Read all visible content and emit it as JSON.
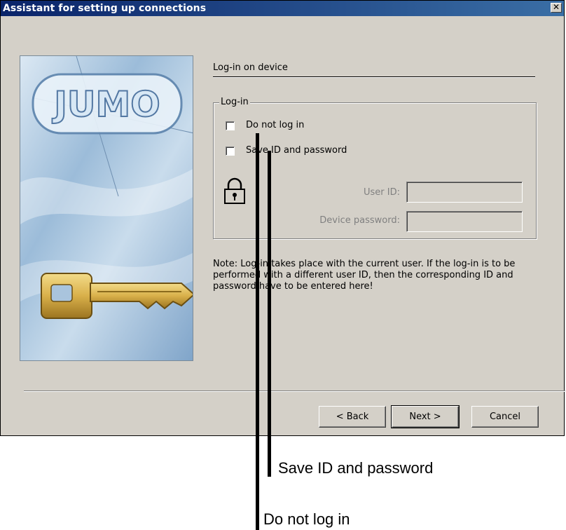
{
  "window": {
    "title": "Assistant for setting up connections",
    "close_glyph": "✕"
  },
  "banner": {
    "logo_text": "JUMO",
    "key_icon": "key-icon"
  },
  "page": {
    "heading": "Log-in on device"
  },
  "login_group": {
    "legend": "Log-in",
    "do_not_login": {
      "label": "Do not log in",
      "checked": false
    },
    "save_id": {
      "label": "Save ID and password",
      "checked": false
    },
    "lock_icon": "lock-icon",
    "user_id_label": "User ID:",
    "user_id_value": "",
    "password_label": "Device password:",
    "password_value": ""
  },
  "note": "Note: Log-in takes place with the current user. If the log-in is to be performed with a different user ID, then the corresponding ID and password have to be entered here!",
  "buttons": {
    "back": "< Back",
    "next": "Next >",
    "cancel": "Cancel"
  },
  "callouts": {
    "save_id": "Save ID and password",
    "do_not_login": "Do not log in"
  },
  "colors": {
    "titlebar_start": "#0a246a",
    "titlebar_end": "#3a6ea5",
    "dialog_bg": "#d4d0c8"
  }
}
